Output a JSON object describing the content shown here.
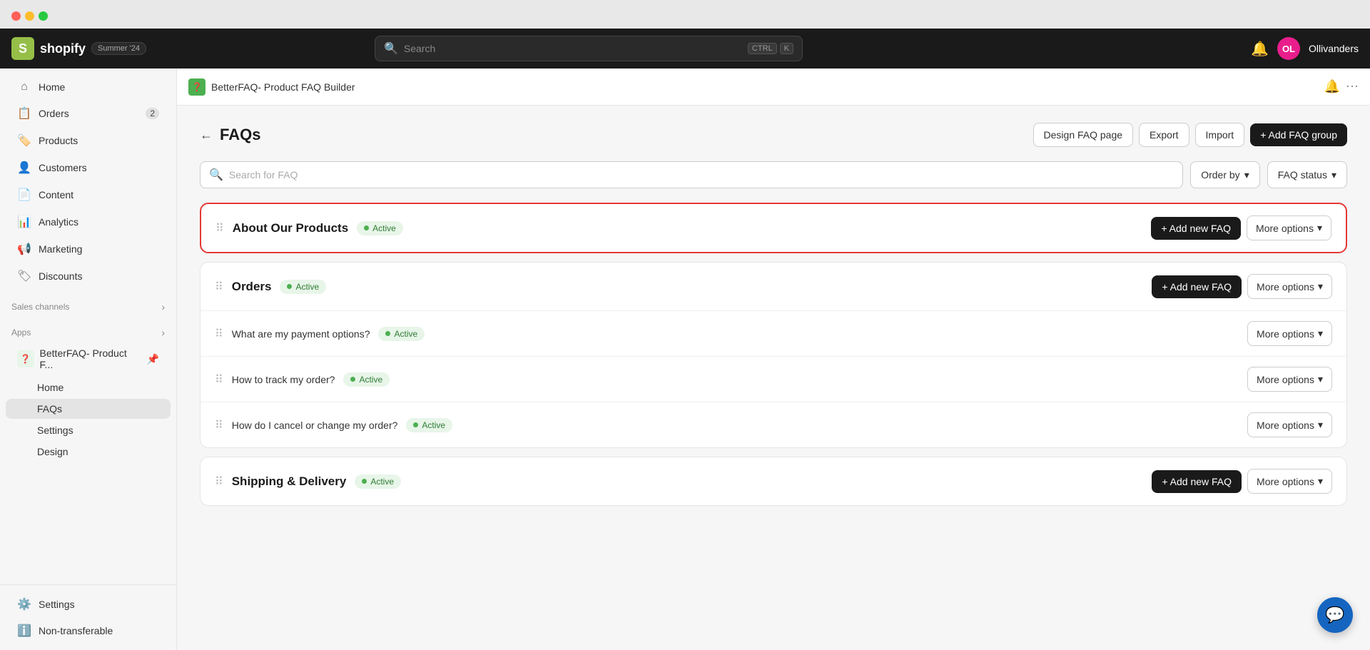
{
  "window": {
    "traffic_lights": [
      "red",
      "yellow",
      "green"
    ]
  },
  "topbar": {
    "logo_letter": "S",
    "brand": "shopify",
    "summer_badge": "Summer '24",
    "search_placeholder": "Search",
    "shortcut_ctrl": "CTRL",
    "shortcut_k": "K",
    "notification_icon": "🔔",
    "avatar_initials": "OL",
    "user_name": "Ollivanders"
  },
  "sidebar": {
    "items": [
      {
        "id": "home",
        "label": "Home",
        "icon": "⌂",
        "badge": null
      },
      {
        "id": "orders",
        "label": "Orders",
        "icon": "📋",
        "badge": "2"
      },
      {
        "id": "products",
        "label": "Products",
        "icon": "🏷️",
        "badge": null
      },
      {
        "id": "customers",
        "label": "Customers",
        "icon": "👤",
        "badge": null
      },
      {
        "id": "content",
        "label": "Content",
        "icon": "📄",
        "badge": null
      },
      {
        "id": "analytics",
        "label": "Analytics",
        "icon": "📊",
        "badge": null
      },
      {
        "id": "marketing",
        "label": "Marketing",
        "icon": "📢",
        "badge": null
      },
      {
        "id": "discounts",
        "label": "Discounts",
        "icon": "🏷",
        "badge": null
      }
    ],
    "sales_channels_label": "Sales channels",
    "apps_label": "Apps",
    "app_name": "BetterFAQ- Product F...",
    "app_sub_items": [
      {
        "id": "home",
        "label": "Home"
      },
      {
        "id": "faqs",
        "label": "FAQs",
        "active": true
      },
      {
        "id": "settings",
        "label": "Settings"
      },
      {
        "id": "design",
        "label": "Design"
      }
    ],
    "settings_label": "Settings",
    "non_transferable_label": "Non-transferable"
  },
  "sec_header": {
    "app_icon": "❓",
    "title": "BetterFAQ- Product FAQ Builder",
    "notification_icon": "🔔",
    "more_icon": "⋯"
  },
  "page": {
    "back_arrow": "←",
    "title": "FAQs",
    "actions": [
      {
        "id": "design-faq-page",
        "label": "Design FAQ page"
      },
      {
        "id": "export",
        "label": "Export"
      },
      {
        "id": "import",
        "label": "Import"
      },
      {
        "id": "add-faq-group",
        "label": "+ Add FAQ group",
        "primary": true
      }
    ],
    "search_placeholder": "Search for FAQ",
    "filter_order_by": "Order by",
    "filter_faq_status": "FAQ status",
    "faq_groups": [
      {
        "id": "about-our-products",
        "title": "About Our Products",
        "status": "Active",
        "highlighted": true,
        "add_faq_label": "+ Add new FAQ",
        "more_options_label": "More options",
        "faqs": []
      },
      {
        "id": "orders",
        "title": "Orders",
        "status": "Active",
        "highlighted": false,
        "add_faq_label": "+ Add new FAQ",
        "more_options_label": "More options",
        "faqs": [
          {
            "id": "faq-1",
            "title": "What are my payment options?",
            "status": "Active",
            "more_options_label": "More options"
          },
          {
            "id": "faq-2",
            "title": "How to track my order?",
            "status": "Active",
            "more_options_label": "More options"
          },
          {
            "id": "faq-3",
            "title": "How do I cancel or change my order?",
            "status": "Active",
            "more_options_label": "More options"
          }
        ]
      },
      {
        "id": "shipping-delivery",
        "title": "Shipping & Delivery",
        "status": "Active",
        "highlighted": false,
        "add_faq_label": "+ Add new FAQ",
        "more_options_label": "More options",
        "faqs": []
      }
    ]
  },
  "chat_button": {
    "icon": "💬"
  },
  "colors": {
    "active_badge_bg": "#e8f5e9",
    "active_badge_text": "#2e7d32",
    "active_dot": "#4caf50",
    "highlight_border": "#e53935",
    "primary_btn_bg": "#1a1a1a"
  }
}
